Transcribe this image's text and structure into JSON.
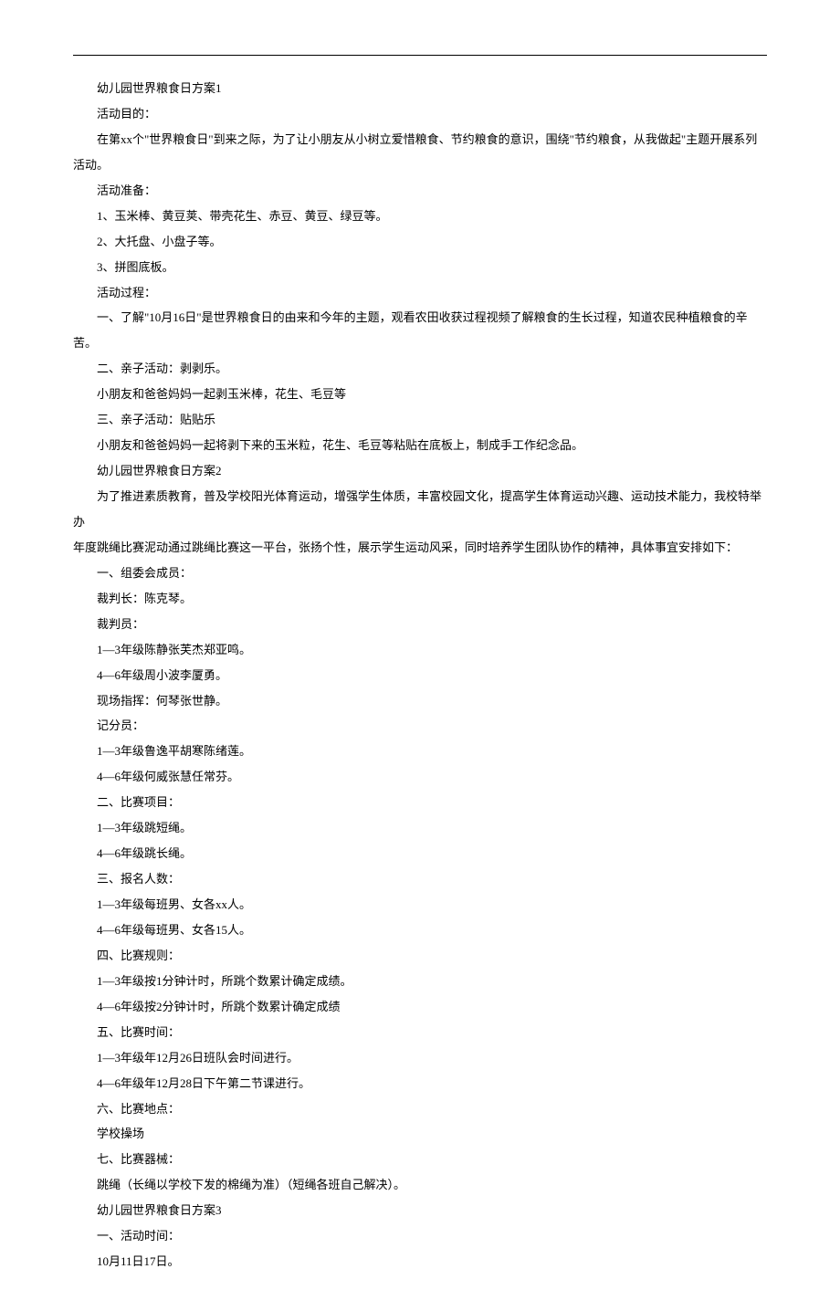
{
  "lines": [
    "幼儿园世界粮食日方案1",
    "活动目的：",
    "在第xx个\"世界粮食日\"到来之际，为了让小朋友从小树立爱惜粮食、节约粮食的意识，围绕\"节约粮食，从我做起\"主题开展系列活动。",
    "活动准备：",
    "1、玉米棒、黄豆荚、带壳花生、赤豆、黄豆、绿豆等。",
    "2、大托盘、小盘子等。",
    "3、拼图底板。",
    "活动过程：",
    "一、了解\"10月16日\"是世界粮食日的由来和今年的主题，观看农田收获过程视频了解粮食的生长过程，知道农民种植粮食的辛苦。",
    "二、亲子活动：剥剥乐。",
    "小朋友和爸爸妈妈一起剥玉米棒，花生、毛豆等",
    "三、亲子活动：贴贴乐",
    "小朋友和爸爸妈妈一起将剥下来的玉米粒，花生、毛豆等粘贴在底板上，制成手工作纪念品。",
    "幼儿园世界粮食日方案2"
  ],
  "wrap1_a": "　　为了推进素质教育，普及学校阳光体育运动，增强学生体质，丰富校园文化，提高学生体育运动兴趣、运动技术能力，我校特举办",
  "wrap1_b": "年度跳绳比赛泥动通过跳绳比赛这一平台，张扬个性，展示学生运动风采，同时培养学生团队协作的精神，具体事宜安排如下：",
  "lines2": [
    "一、组委会成员：",
    "裁判长：陈克琴。",
    "裁判员：",
    "1—3年级陈静张芙杰郑亚鸣。",
    "4—6年级周小波李厦勇。",
    "现场指挥：何琴张世静。",
    "记分员：",
    "1—3年级鲁逸平胡寒陈绪莲。",
    "4—6年级何威张慧任常芬。",
    "二、比赛项目：",
    "1—3年级跳短绳。",
    "4—6年级跳长绳。",
    "三、报名人数：",
    "1—3年级每班男、女各xx人。",
    "4—6年级每班男、女各15人。",
    "四、比赛规则：",
    "1—3年级按1分钟计时，所跳个数累计确定成绩。",
    "4—6年级按2分钟计时，所跳个数累计确定成绩",
    "五、比赛时间：",
    "1—3年级年12月26日班队会时间进行。",
    "4—6年级年12月28日下午第二节课进行。",
    "六、比赛地点：",
    "学校操场",
    "七、比赛器械：",
    "跳绳（长绳以学校下发的棉绳为准）（短绳各班自己解决）。",
    "幼儿园世界粮食日方案3",
    "一、活动时间：",
    "10月11日17日。"
  ]
}
